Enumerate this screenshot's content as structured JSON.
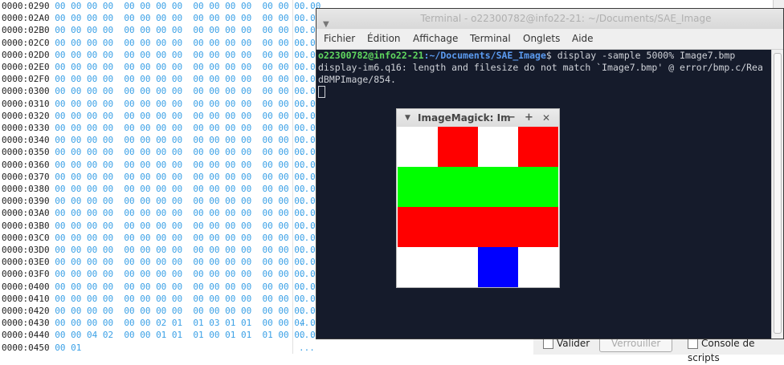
{
  "hex_view": {
    "rows": [
      {
        "addr": "0000:0290",
        "bytes": "00 00 00 00  00 00 00 00  00 00 00 00  00 00 00 00",
        "ascii": "...."
      },
      {
        "addr": "0000:02A0",
        "bytes": "00 00 00 00  00 00 00 00  00 00 00 00  00 00 00 00",
        "ascii": "...."
      },
      {
        "addr": "0000:02B0",
        "bytes": "00 00 00 00  00 00 00 00  00 00 00 00  00 00 00 00",
        "ascii": "...."
      },
      {
        "addr": "0000:02C0",
        "bytes": "00 00 00 00  00 00 00 00  00 00 00 00  00 00 00 00",
        "ascii": "...."
      },
      {
        "addr": "0000:02D0",
        "bytes": "00 00 00 00  00 00 00 00  00 00 00 00  00 00 00 00",
        "ascii": "...."
      },
      {
        "addr": "0000:02E0",
        "bytes": "00 00 00 00  00 00 00 00  00 00 00 00  00 00 00 00",
        "ascii": "...."
      },
      {
        "addr": "0000:02F0",
        "bytes": "00 00 00 00  00 00 00 00  00 00 00 00  00 00 00 00",
        "ascii": "...."
      },
      {
        "addr": "0000:0300",
        "bytes": "00 00 00 00  00 00 00 00  00 00 00 00  00 00 00 00",
        "ascii": "...."
      },
      {
        "addr": "0000:0310",
        "bytes": "00 00 00 00  00 00 00 00  00 00 00 00  00 00 00 00",
        "ascii": "...."
      },
      {
        "addr": "0000:0320",
        "bytes": "00 00 00 00  00 00 00 00  00 00 00 00  00 00 00 00",
        "ascii": "...."
      },
      {
        "addr": "0000:0330",
        "bytes": "00 00 00 00  00 00 00 00  00 00 00 00  00 00 00 00",
        "ascii": "...."
      },
      {
        "addr": "0000:0340",
        "bytes": "00 00 00 00  00 00 00 00  00 00 00 00  00 00 00 00",
        "ascii": "...."
      },
      {
        "addr": "0000:0350",
        "bytes": "00 00 00 00  00 00 00 00  00 00 00 00  00 00 00 00",
        "ascii": "...."
      },
      {
        "addr": "0000:0360",
        "bytes": "00 00 00 00  00 00 00 00  00 00 00 00  00 00 00 00",
        "ascii": "...."
      },
      {
        "addr": "0000:0370",
        "bytes": "00 00 00 00  00 00 00 00  00 00 00 00  00 00 00 00",
        "ascii": "...."
      },
      {
        "addr": "0000:0380",
        "bytes": "00 00 00 00  00 00 00 00  00 00 00 00  00 00 00 00",
        "ascii": "...."
      },
      {
        "addr": "0000:0390",
        "bytes": "00 00 00 00  00 00 00 00  00 00 00 00  00 00 00 00",
        "ascii": "...."
      },
      {
        "addr": "0000:03A0",
        "bytes": "00 00 00 00  00 00 00 00  00 00 00 00  00 00 00 00",
        "ascii": "...."
      },
      {
        "addr": "0000:03B0",
        "bytes": "00 00 00 00  00 00 00 00  00 00 00 00  00 00 00 00",
        "ascii": "...."
      },
      {
        "addr": "0000:03C0",
        "bytes": "00 00 00 00  00 00 00 00  00 00 00 00  00 00 00 00",
        "ascii": "...."
      },
      {
        "addr": "0000:03D0",
        "bytes": "00 00 00 00  00 00 00 00  00 00 00 00  00 00 00 00",
        "ascii": "...."
      },
      {
        "addr": "0000:03E0",
        "bytes": "00 00 00 00  00 00 00 00  00 00 00 00  00 00 00 00",
        "ascii": "...."
      },
      {
        "addr": "0000:03F0",
        "bytes": "00 00 00 00  00 00 00 00  00 00 00 00  00 00 00 00",
        "ascii": "...."
      },
      {
        "addr": "0000:0400",
        "bytes": "00 00 00 00  00 00 00 00  00 00 00 00  00 00 00 00",
        "ascii": "...."
      },
      {
        "addr": "0000:0410",
        "bytes": "00 00 00 00  00 00 00 00  00 00 00 00  00 00 00 00",
        "ascii": "...."
      },
      {
        "addr": "0000:0420",
        "bytes": "00 00 00 00  00 00 00 00  00 00 00 00  00 00 00 00",
        "ascii": "...."
      },
      {
        "addr": "0000:0430",
        "bytes": "00 00 00 00  00 00 02 01  01 03 01 01  00 00 04 00",
        "ascii": "...."
      },
      {
        "addr": "0000:0440",
        "bytes": "00 00 04 02  00 00 01 01  01 00 01 01  01 00 00 00",
        "ascii": "...."
      },
      {
        "addr": "0000:0450",
        "bytes": "00 01",
        "ascii": "..."
      }
    ]
  },
  "terminal": {
    "title": "Terminal - o22300782@info22-21: ~/Documents/SAE_Image",
    "menu": [
      "Fichier",
      "Édition",
      "Affichage",
      "Terminal",
      "Onglets",
      "Aide"
    ],
    "prompt_user": "o22300782@info22-21",
    "prompt_path": ":~/Documents/SAE_Image",
    "prompt_symbol": "$",
    "command": " display -sample 5000% Image7.bmp",
    "output_line1": "display-im6.q16: length and filesize do not match `Image7.bmp' @ error/bmp.c/Rea",
    "output_line2": "dBMPImage/854."
  },
  "imagemagick": {
    "title": "ImageMagick: Im",
    "minimize": "−",
    "maximize": "+",
    "close": "✕",
    "pixels": [
      [
        "#ffffff",
        "#ff0000",
        "#ffffff",
        "#ff0000"
      ],
      [
        "#00ff00",
        "#00ff00",
        "#00ff00",
        "#00ff00"
      ],
      [
        "#ff0000",
        "#ff0000",
        "#ff0000",
        "#ff0000"
      ],
      [
        "#ffffff",
        "#ffffff",
        "#0000ff",
        "#ffffff"
      ]
    ]
  },
  "bottom_bar": {
    "validate_label": "Valider",
    "verify_label": "Verrouiller",
    "console_label": "Console de scripts"
  }
}
